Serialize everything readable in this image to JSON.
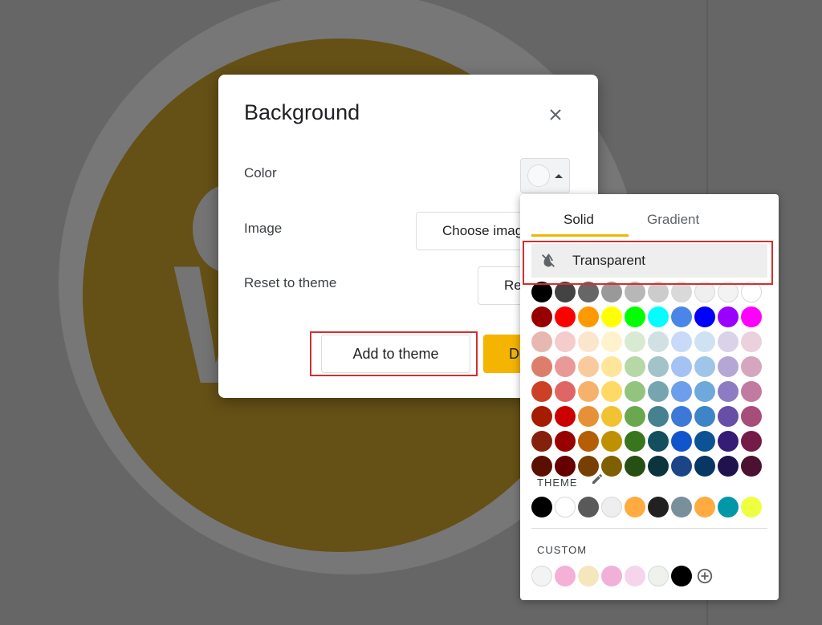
{
  "dialog": {
    "title": "Background",
    "color_label": "Color",
    "image_label": "Image",
    "reset_label": "Reset to theme",
    "choose_image_button": "Choose image",
    "reset_button": "Reset",
    "add_to_theme_button": "Add to theme",
    "done_button": "Done"
  },
  "picker": {
    "tabs": [
      "Solid",
      "Gradient"
    ],
    "active_tab": "Solid",
    "transparent_label": "Transparent",
    "theme_label": "THEME",
    "custom_label": "CUSTOM",
    "grid_colors": [
      [
        "#000000",
        "#434343",
        "#666666",
        "#999999",
        "#b7b7b7",
        "#cccccc",
        "#d9d9d9",
        "#efefef",
        "#f3f3f3",
        "#ffffff"
      ],
      [
        "#980000",
        "#ff0000",
        "#ff9900",
        "#ffff00",
        "#00ff00",
        "#00ffff",
        "#4a86e8",
        "#0000ff",
        "#9900ff",
        "#ff00ff"
      ],
      [
        "#e6b8af",
        "#f4cccc",
        "#fce5cd",
        "#fff2cc",
        "#d9ead3",
        "#d0e0e3",
        "#c9daf8",
        "#cfe2f3",
        "#d9d2e9",
        "#ead1dc"
      ],
      [
        "#dd7e6b",
        "#ea9999",
        "#f9cb9c",
        "#ffe599",
        "#b6d7a8",
        "#a2c4c9",
        "#a4c2f4",
        "#9fc5e8",
        "#b4a7d6",
        "#d5a6bd"
      ],
      [
        "#cc4125",
        "#e06666",
        "#f6b26b",
        "#ffd966",
        "#93c47d",
        "#76a5af",
        "#6d9eeb",
        "#6fa8dc",
        "#8e7cc3",
        "#c27ba0"
      ],
      [
        "#a61c00",
        "#cc0000",
        "#e69138",
        "#f1c232",
        "#6aa84f",
        "#45818e",
        "#3c78d8",
        "#3d85c6",
        "#674ea7",
        "#a64d79"
      ],
      [
        "#85200c",
        "#990000",
        "#b45f06",
        "#bf9000",
        "#38761d",
        "#134f5c",
        "#1155cc",
        "#0b5394",
        "#351c75",
        "#741b47"
      ],
      [
        "#5b0f00",
        "#660000",
        "#783f04",
        "#7f6000",
        "#274e13",
        "#0c343d",
        "#1c4587",
        "#073763",
        "#20124d",
        "#4c1130"
      ]
    ],
    "theme_colors": [
      "#000000",
      "#ffffff",
      "#595959",
      "#eeeeee",
      "#ffab40",
      "#212121",
      "#78909c",
      "#ffab40",
      "#0097a7",
      "#eeff41"
    ],
    "custom_colors": [
      "#f3f3f3",
      "#f4b0d5",
      "#f6e6bd",
      "#f2b0d8",
      "#f6d5ec",
      "#eef1ec",
      "#000000"
    ]
  },
  "icons": {
    "close": "close-icon",
    "transparent": "format-color-reset-icon",
    "theme_edit": "pencil-icon",
    "add_custom": "add-circle-icon"
  }
}
